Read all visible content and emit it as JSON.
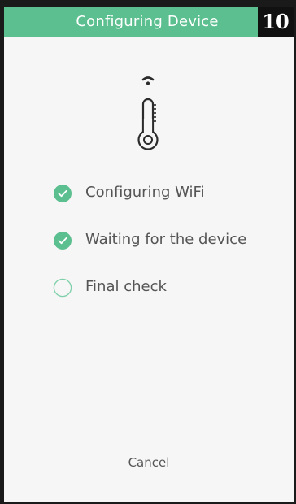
{
  "header": {
    "title": "Configuring Device",
    "badge": "10",
    "color": "#5cbf8f"
  },
  "device": {
    "icon": "thermometer-icon",
    "signal_icon": "wifi-signal-icon"
  },
  "steps": [
    {
      "label": "Configuring WiFi",
      "status": "done",
      "icon": "check-circle-icon"
    },
    {
      "label": "Waiting for the device",
      "status": "done",
      "icon": "check-circle-icon"
    },
    {
      "label": "Final check",
      "status": "pending",
      "icon": "empty-circle-icon"
    }
  ],
  "actions": {
    "cancel_label": "Cancel"
  },
  "colors": {
    "accent": "#5cbf8f",
    "text": "#555555",
    "background": "#f6f6f6"
  }
}
